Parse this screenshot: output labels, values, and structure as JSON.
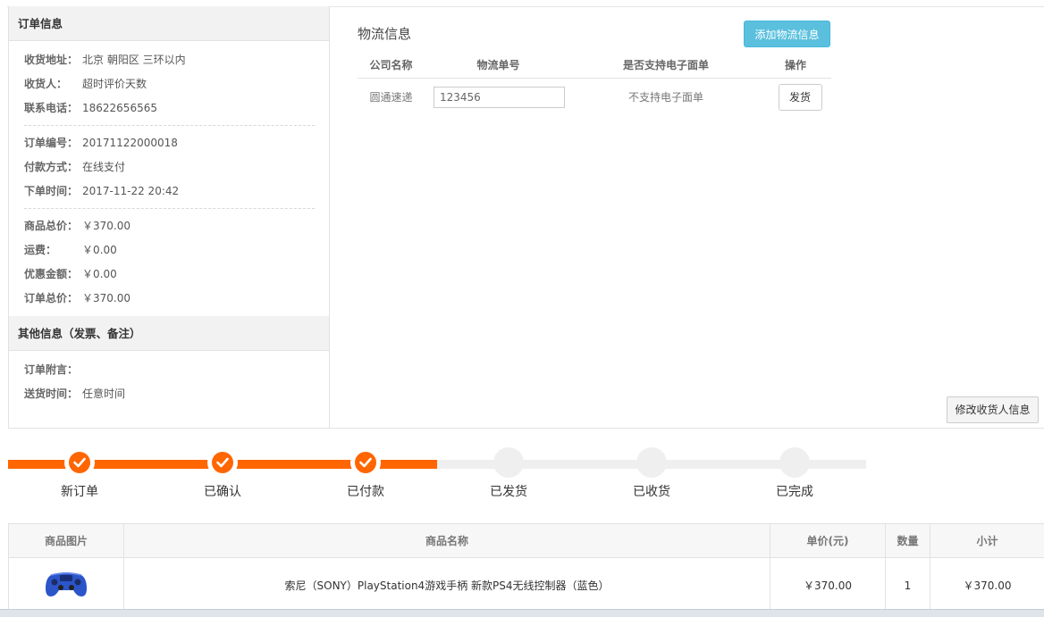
{
  "order_info": {
    "title": "订单信息",
    "groups": [
      [
        {
          "label": "收货地址：",
          "value": "北京 朝阳区 三环以内"
        },
        {
          "label": "收货人：",
          "value": "超时评价天数"
        },
        {
          "label": "联系电话：",
          "value": "18622656565"
        }
      ],
      [
        {
          "label": "订单编号：",
          "value": "20171122000018"
        },
        {
          "label": "付款方式：",
          "value": "在线支付"
        },
        {
          "label": "下单时间：",
          "value": "2017-11-22 20:42"
        }
      ],
      [
        {
          "label": "商品总价：",
          "value": "￥370.00"
        },
        {
          "label": "运费：",
          "value": "￥0.00"
        },
        {
          "label": "优惠金额：",
          "value": "￥0.00"
        },
        {
          "label": "订单总价：",
          "value": "￥370.00"
        }
      ]
    ]
  },
  "other_info": {
    "title": "其他信息（发票、备注）",
    "rows": [
      {
        "label": "订单附言：",
        "value": ""
      },
      {
        "label": "送货时间：",
        "value": "任意时间"
      }
    ]
  },
  "logistics": {
    "title": "物流信息",
    "add_button": "添加物流信息",
    "headers": [
      "公司名称",
      "物流单号",
      "是否支持电子面单",
      "操作"
    ],
    "rows": [
      {
        "company": "圆通速递",
        "tracking_no": "123456",
        "e_waybill": "不支持电子面单",
        "action": "发货"
      }
    ],
    "edit_button": "修改收货人信息"
  },
  "progress": {
    "accent": "#ff6600",
    "inactive": "#efefef",
    "completed_steps": 3,
    "steps": [
      "新订单",
      "已确认",
      "已付款",
      "已发货",
      "已收货",
      "已完成"
    ]
  },
  "goods": {
    "headers": [
      "商品图片",
      "商品名称",
      "单价(元)",
      "数量",
      "小计"
    ],
    "rows": [
      {
        "image": "gamepad-icon",
        "name": "索尼（SONY）PlayStation4游戏手柄 新款PS4无线控制器（蓝色）",
        "price": "￥370.00",
        "qty": "1",
        "subtotal": "￥370.00"
      }
    ]
  }
}
